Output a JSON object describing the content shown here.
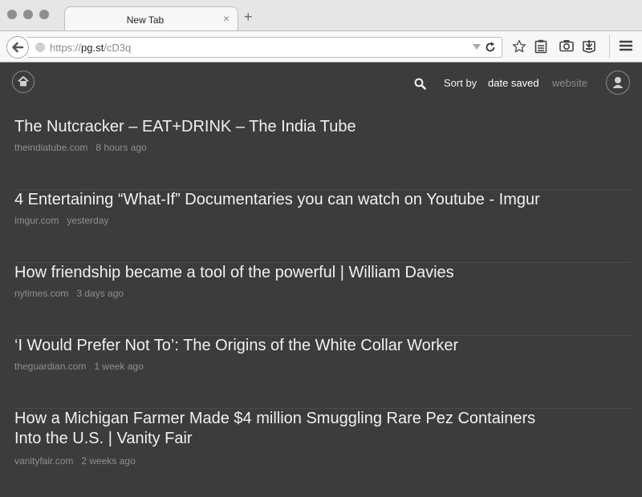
{
  "browser": {
    "tab": {
      "title": "New Tab",
      "close": "×"
    },
    "new_tab": "+",
    "url": {
      "scheme": "https://",
      "host": "pg.st",
      "path": "/cD3q"
    }
  },
  "toolbar_icons": [
    "star-icon",
    "reading-list-icon",
    "screenshot-icon",
    "pocket-icon",
    "hamburger-menu-icon"
  ],
  "page": {
    "sort_label": "Sort by",
    "sort_options": [
      "date saved",
      "website"
    ],
    "active_sort": "date saved"
  },
  "articles": [
    {
      "title": "The Nutcracker – EAT+DRINK – The India Tube",
      "domain": "theindiatube.com",
      "time": "8 hours ago"
    },
    {
      "title": "4 Entertaining “What-If” Documentaries you can watch on Youtube - Imgur",
      "domain": "imgur.com",
      "time": "yesterday"
    },
    {
      "title": "How friendship became a tool of the powerful | William Davies",
      "domain": "nytimes.com",
      "time": "3 days ago"
    },
    {
      "title": "‘I Would Prefer Not To’: The Origins of the White Collar Worker",
      "domain": "theguardian.com",
      "time": "1 week ago"
    },
    {
      "title": "How a Michigan Farmer Made $4 million Smuggling Rare Pez Containers Into the U.S. | Vanity Fair",
      "domain": "vanityfair.com",
      "time": "2 weeks ago"
    }
  ]
}
